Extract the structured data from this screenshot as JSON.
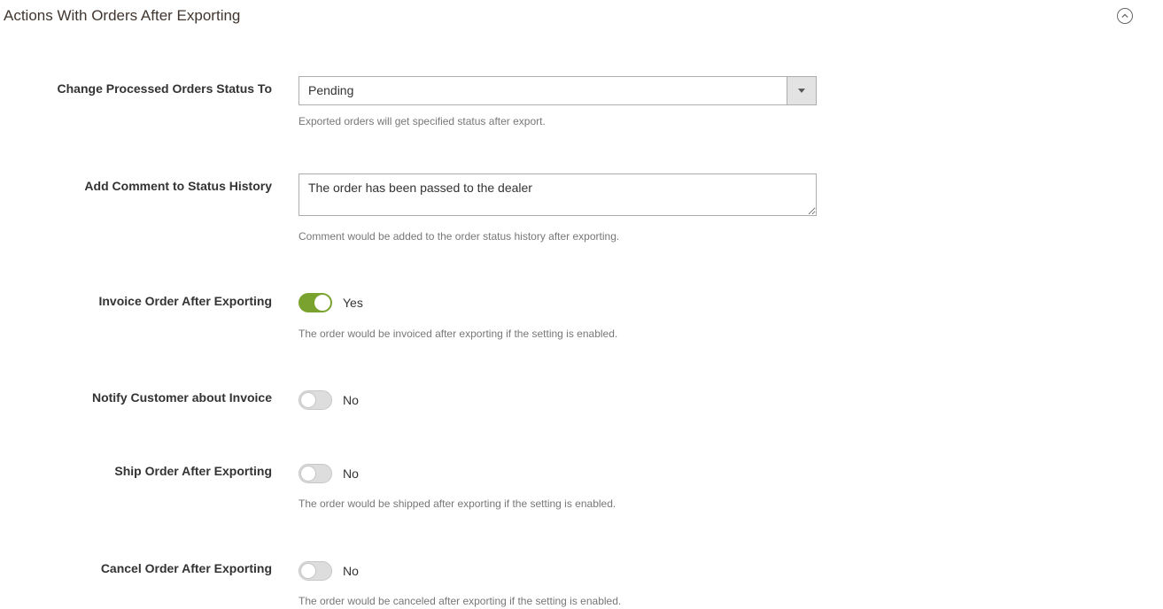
{
  "section": {
    "title": "Actions With Orders After Exporting"
  },
  "fields": {
    "status": {
      "label": "Change Processed Orders Status To",
      "value": "Pending",
      "help": "Exported orders will get specified status after export."
    },
    "comment": {
      "label": "Add Comment to Status History",
      "value": "The order has been passed to the dealer",
      "help": "Comment would be added to the order status history after exporting."
    },
    "invoice": {
      "label": "Invoice Order After Exporting",
      "value": "Yes",
      "help": "The order would be invoiced after exporting if the setting is enabled."
    },
    "notify": {
      "label": "Notify Customer about Invoice",
      "value": "No"
    },
    "ship": {
      "label": "Ship Order After Exporting",
      "value": "No",
      "help": "The order would be shipped after exporting if the setting is enabled."
    },
    "cancel": {
      "label": "Cancel Order After Exporting",
      "value": "No",
      "help": "The order would be canceled after exporting if the setting is enabled."
    }
  }
}
